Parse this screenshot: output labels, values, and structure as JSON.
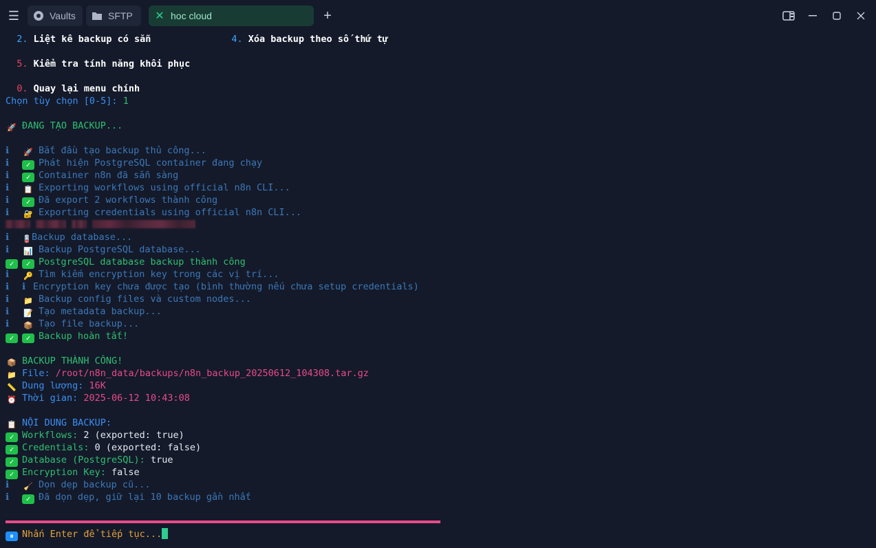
{
  "tabs": [
    {
      "label": "Vaults",
      "icon": "vault-icon"
    },
    {
      "label": "SFTP",
      "icon": "folder-icon"
    },
    {
      "label": "hoc cloud",
      "icon": "close-icon"
    }
  ],
  "menu": {
    "opt2_num": "2.",
    "opt2": "Liệt kê backup có sẵn",
    "opt4_num": "4.",
    "opt4": "Xóa backup theo số thứ tự",
    "opt5_num": "5.",
    "opt5": "Kiểm tra tính năng khôi phục",
    "opt0_num": "0.",
    "opt0": "Quay lại menu chính",
    "prompt": "Chọn tùy chọn [0-5]: ",
    "answer": "1"
  },
  "creating": "ĐANG TẠO BACKUP...",
  "log": [
    "Bắt đầu tạo backup thủ công...",
    "Phát hiện PostgreSQL container đang chạy",
    "Container n8n đã sẵn sàng",
    "Exporting workflows using official n8n CLI...",
    "Đã export 2 workflows thành công",
    "Exporting credentials using official n8n CLI...",
    "Backup database...",
    "Backup PostgreSQL database...",
    "PostgreSQL database backup thành công",
    "Tìm kiếm encryption key trong các vị trí...",
    "Encryption key chưa được tạo (bình thường nếu chưa setup credentials)",
    "Backup config files và custom nodes...",
    "Tạo metadata backup...",
    "Tạo file backup...",
    "Backup hoàn tất!"
  ],
  "info_mark": "ℹ",
  "success": {
    "title": "BACKUP THÀNH CÔNG!",
    "file_label": "File: ",
    "file": "/root/n8n_data/backups/n8n_backup_20250612_104308.tar.gz",
    "size_label": "Dung lượng: ",
    "size": "16K",
    "time_label": "Thời gian: ",
    "time": "2025-06-12 10:43:08"
  },
  "content": {
    "title": "NỘI DUNG BACKUP:",
    "workflows_label": "Workflows: ",
    "workflows": "2 (exported: true)",
    "credentials_label": "Credentials: ",
    "credentials": "0 (exported: false)",
    "database_label": "Database (PostgreSQL): ",
    "database": "true",
    "enc_label": "Encryption Key: ",
    "enc": "false"
  },
  "cleanup": [
    "Dọn dẹp backup cũ...",
    "Đã dọn dẹp, giữ lại 10 backup gần nhất"
  ],
  "continue": "Nhấn Enter để tiếp tục..."
}
